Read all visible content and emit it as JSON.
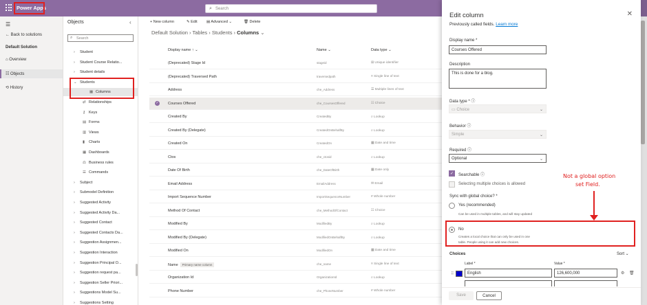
{
  "app": {
    "title": "Power Apps"
  },
  "search": {
    "placeholder": "Search"
  },
  "left_nav": {
    "back": "Back to solutions",
    "solution": "Default Solution",
    "items": [
      "Overview",
      "Objects",
      "History"
    ]
  },
  "objects_pane": {
    "title": "Objects",
    "search_placeholder": "Search",
    "tree": [
      {
        "label": "Student",
        "indent": 0,
        "chev": ">"
      },
      {
        "label": "Student Course Relatio...",
        "indent": 0,
        "chev": ">"
      },
      {
        "label": "Student details",
        "indent": 0,
        "chev": ">"
      },
      {
        "label": "Students",
        "indent": 0,
        "chev": "v"
      },
      {
        "label": "Columns",
        "indent": 1,
        "chev": ""
      },
      {
        "label": "Relationships",
        "indent": 1,
        "chev": ""
      },
      {
        "label": "Keys",
        "indent": 1,
        "chev": ""
      },
      {
        "label": "Forms",
        "indent": 1,
        "chev": ""
      },
      {
        "label": "Views",
        "indent": 1,
        "chev": ""
      },
      {
        "label": "Charts",
        "indent": 1,
        "chev": ""
      },
      {
        "label": "Dashboards",
        "indent": 1,
        "chev": ""
      },
      {
        "label": "Business rules",
        "indent": 1,
        "chev": ""
      },
      {
        "label": "Commands",
        "indent": 1,
        "chev": ""
      },
      {
        "label": "Subject",
        "indent": 0,
        "chev": ">"
      },
      {
        "label": "Submodel Definition",
        "indent": 0,
        "chev": ">"
      },
      {
        "label": "Suggested Activity",
        "indent": 0,
        "chev": ">"
      },
      {
        "label": "Suggested Activity Da...",
        "indent": 0,
        "chev": ">"
      },
      {
        "label": "Suggested Contact",
        "indent": 0,
        "chev": ">"
      },
      {
        "label": "Suggested Contacts Da...",
        "indent": 0,
        "chev": ">"
      },
      {
        "label": "Suggestion Assignmen...",
        "indent": 0,
        "chev": ">"
      },
      {
        "label": "Suggestion Interaction",
        "indent": 0,
        "chev": ">"
      },
      {
        "label": "Suggestion Principal O...",
        "indent": 0,
        "chev": ">"
      },
      {
        "label": "Suggestion request pa...",
        "indent": 0,
        "chev": ">"
      },
      {
        "label": "Suggestion Seller Priori...",
        "indent": 0,
        "chev": ">"
      },
      {
        "label": "Suggestions Model Su...",
        "indent": 0,
        "chev": ">"
      },
      {
        "label": "Suggestions Setting",
        "indent": 0,
        "chev": ">"
      }
    ]
  },
  "command_bar": {
    "new_column": "New column",
    "edit": "Edit",
    "advanced": "Advanced",
    "delete": "Delete"
  },
  "breadcrumb": {
    "a": "Default Solution",
    "b": "Tables",
    "c": "Students",
    "d": "Columns"
  },
  "table": {
    "headers": {
      "display_name": "Display name",
      "name": "Name",
      "data_type": "Data type"
    },
    "rows": [
      {
        "display": "(Deprecated) Stage Id",
        "name": "stageid",
        "type": "Unique identifier"
      },
      {
        "display": "(Deprecated) Traversed Path",
        "name": "traversedpath",
        "type": "Single line of text"
      },
      {
        "display": "Address",
        "name": "che_Address",
        "type": "Multiple lines of text"
      },
      {
        "display": "Courses Offered",
        "name": "che_CoursesOffered",
        "type": "Choice"
      },
      {
        "display": "Created By",
        "name": "CreatedBy",
        "type": "Lookup"
      },
      {
        "display": "Created By (Delegate)",
        "name": "CreatedOnBehalfBy",
        "type": "Lookup"
      },
      {
        "display": "Created On",
        "name": "CreatedOn",
        "type": "Date and time"
      },
      {
        "display": "Ctos",
        "name": "che_ctosid",
        "type": "Lookup"
      },
      {
        "display": "Date Of Birth",
        "name": "che_DateOfBirth",
        "type": "Date only"
      },
      {
        "display": "Email Address",
        "name": "EmailAddress",
        "type": "Email"
      },
      {
        "display": "Import Sequence Number",
        "name": "ImportSequenceNumber",
        "type": "Whole number"
      },
      {
        "display": "Method Of Contact",
        "name": "che_MethodOfContact",
        "type": "Choice"
      },
      {
        "display": "Modified By",
        "name": "ModifiedBy",
        "type": "Lookup"
      },
      {
        "display": "Modified By (Delegate)",
        "name": "ModifiedOnBehalfBy",
        "type": "Lookup"
      },
      {
        "display": "Modified On",
        "name": "ModifiedOn",
        "type": "Date and time"
      },
      {
        "display": "Name",
        "name": "che_name",
        "type": "Single line of text",
        "chip": "Primary name column"
      },
      {
        "display": "Organization Id",
        "name": "OrganizationId",
        "type": "Lookup"
      },
      {
        "display": "Phone Number",
        "name": "che_PhoneNumber",
        "type": "Whole number"
      }
    ]
  },
  "panel": {
    "title": "Edit column",
    "subtitle": "Previously called fields.",
    "learn_more": "Learn more",
    "display_name_label": "Display name *",
    "display_name_value": "Courses Offered",
    "description_label": "Description",
    "description_value": "This is done for a blog.",
    "data_type_label": "Data type *",
    "data_type_value": "Choice",
    "behavior_label": "Behavior",
    "behavior_value": "Simple",
    "required_label": "Required",
    "required_value": "Optional",
    "searchable": "Searchable",
    "multiple": "Selecting multiple choices is allowed",
    "sync_label": "Sync with global choice? *",
    "yes_label": "Yes (recommended)",
    "yes_desc": "Can be used in multiple tables, and will stay updated",
    "no_label": "No",
    "no_desc_1": "Creates a local choice that can only be used in one",
    "no_desc_2": "table. People using it can add new choices.",
    "choices_label": "Choices",
    "sort": "Sort",
    "label_col": "Label *",
    "value_col": "Value *",
    "choice_label": "English",
    "choice_value": "126,600,000",
    "save": "Save",
    "cancel": "Cancel",
    "swatch_color": "#0000cc"
  },
  "annotation": {
    "line1": "Not a global option",
    "line2": "set Field."
  }
}
